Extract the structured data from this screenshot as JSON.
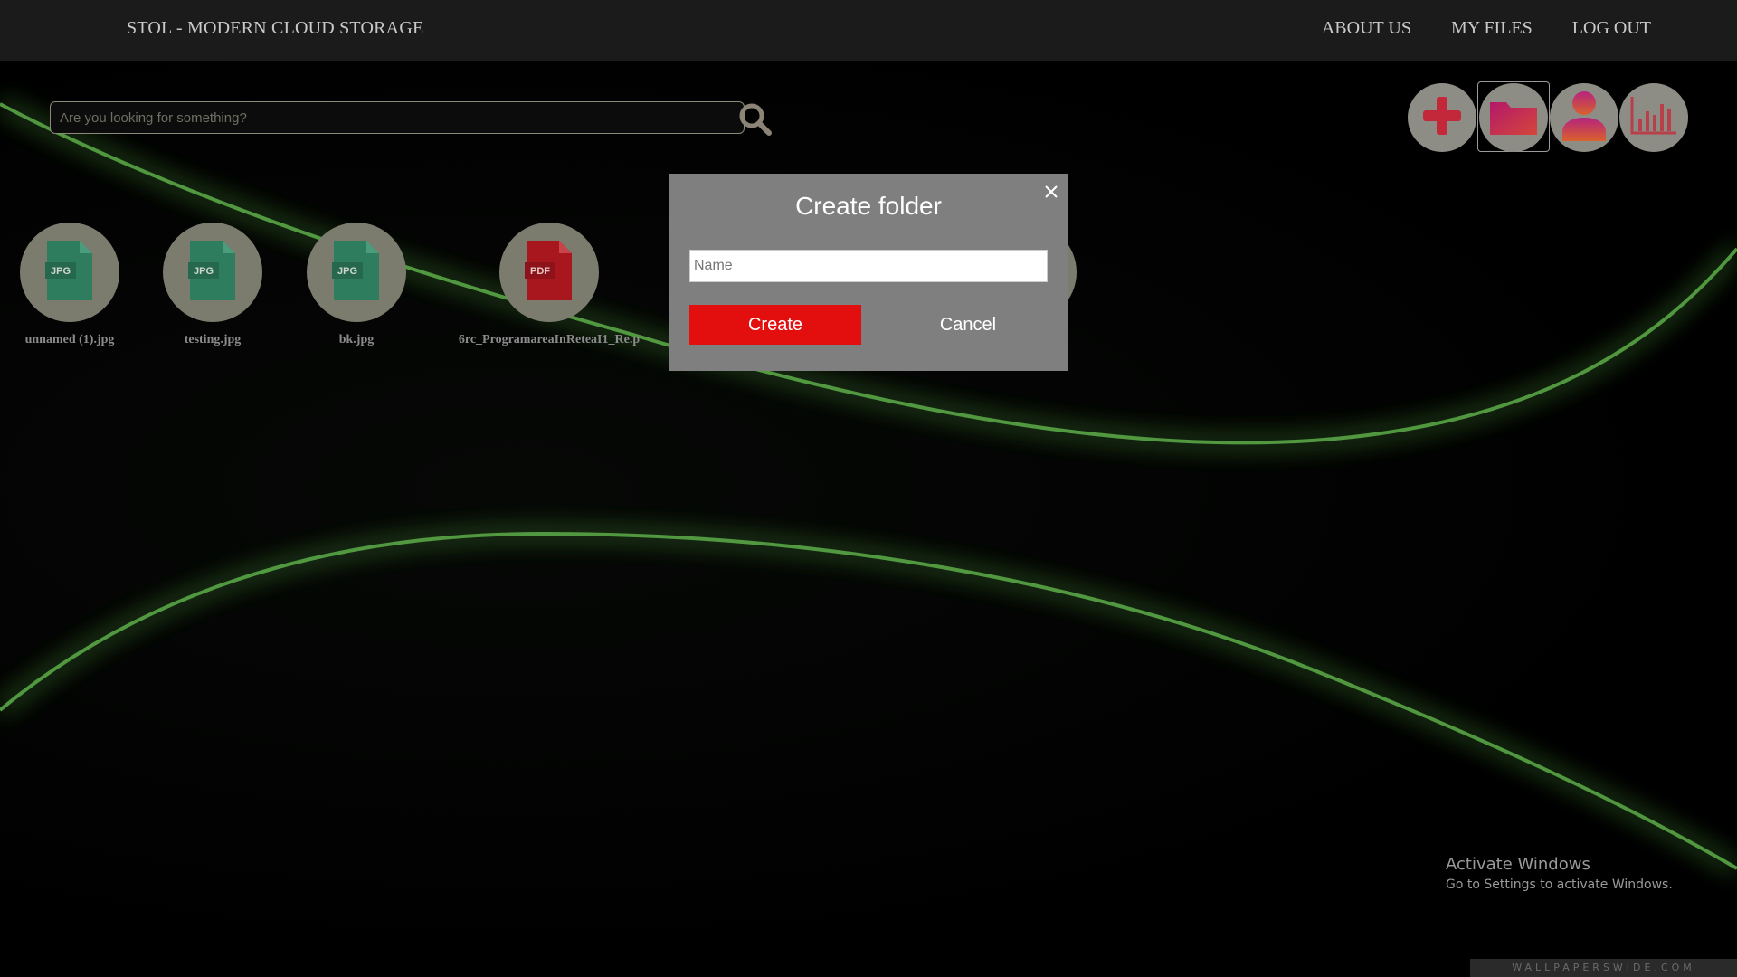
{
  "app": {
    "title": "STOL - MODERN CLOUD STORAGE"
  },
  "nav": {
    "about": "ABOUT US",
    "files": "MY FILES",
    "logout": "LOG OUT"
  },
  "search": {
    "placeholder": "Are you looking for something?"
  },
  "actions": [
    {
      "icon": "plus-icon",
      "label": "upload"
    },
    {
      "icon": "folder-icon",
      "label": "create folder",
      "selected": true
    },
    {
      "icon": "user-icon",
      "label": "profile"
    },
    {
      "icon": "bar-chart-icon",
      "label": "statistics"
    }
  ],
  "files": [
    {
      "name": "unnamed (1).jpg",
      "type": "JPG",
      "color": "#2e7d5e"
    },
    {
      "name": "testing.jpg",
      "type": "JPG",
      "color": "#2e7d5e"
    },
    {
      "name": "bk.jpg",
      "type": "JPG",
      "color": "#2e7d5e"
    },
    {
      "name": "6rc_ProgramareaInReteaI1_Re.p",
      "type": "PDF",
      "color": "#a8161e"
    }
  ],
  "modal": {
    "title": "Create folder",
    "name_placeholder": "Name",
    "create_label": "Create",
    "cancel_label": "Cancel"
  },
  "watermark": {
    "line1": "Activate Windows",
    "line2": "Go to Settings to activate Windows.",
    "site": "WALLPAPERSWIDE.COM"
  },
  "colors": {
    "accent_red": "#e30f0f",
    "glow_green": "#1fbf1f",
    "modal_bg": "#7f7f7f"
  }
}
